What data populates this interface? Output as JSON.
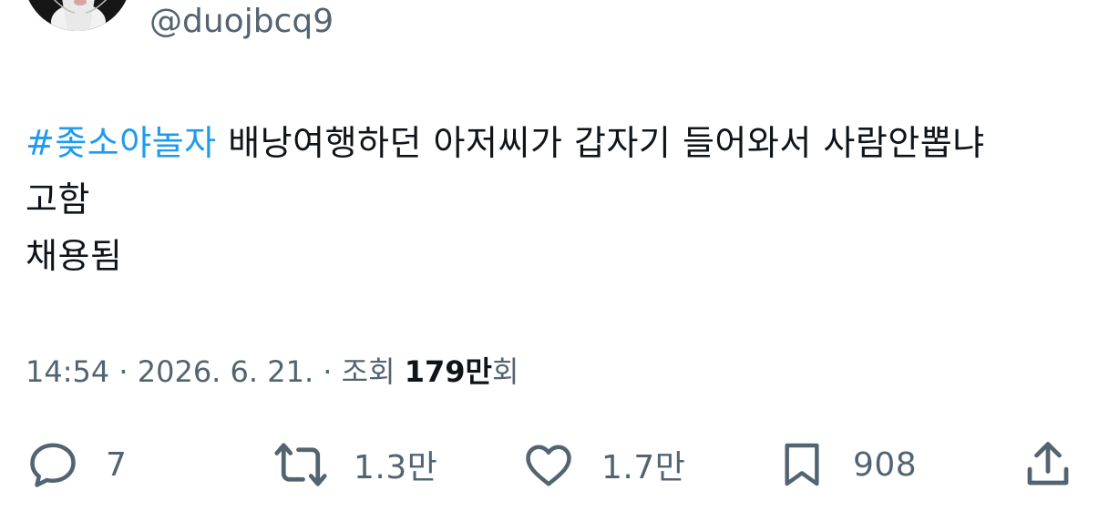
{
  "author": {
    "handle": "@duojbcq9"
  },
  "tweet": {
    "hashtag": "#좆소야놀자",
    "line1": " 배낭여행하던 아저씨가 갑자기 들어와서 사람안뽑냐",
    "line2": "고함",
    "line3": "채용됨"
  },
  "meta": {
    "time": "14:54",
    "separator1": " · ",
    "date": "2026. 6. 21.",
    "separator2": " · ",
    "views_prefix": "조회 ",
    "views_count": "179만",
    "views_suffix": "회"
  },
  "actions": {
    "reply_count": "7",
    "retweet_count": "1.3만",
    "like_count": "1.7만",
    "bookmark_count": "908"
  },
  "colors": {
    "hashtag": "#1d9bf0",
    "secondary_text": "#536471",
    "primary_text": "#0f1419"
  },
  "icons": {
    "reply": "speech-bubble-icon",
    "retweet": "retweet-arrows-icon",
    "like": "heart-icon",
    "bookmark": "bookmark-icon",
    "share": "share-upload-icon"
  }
}
